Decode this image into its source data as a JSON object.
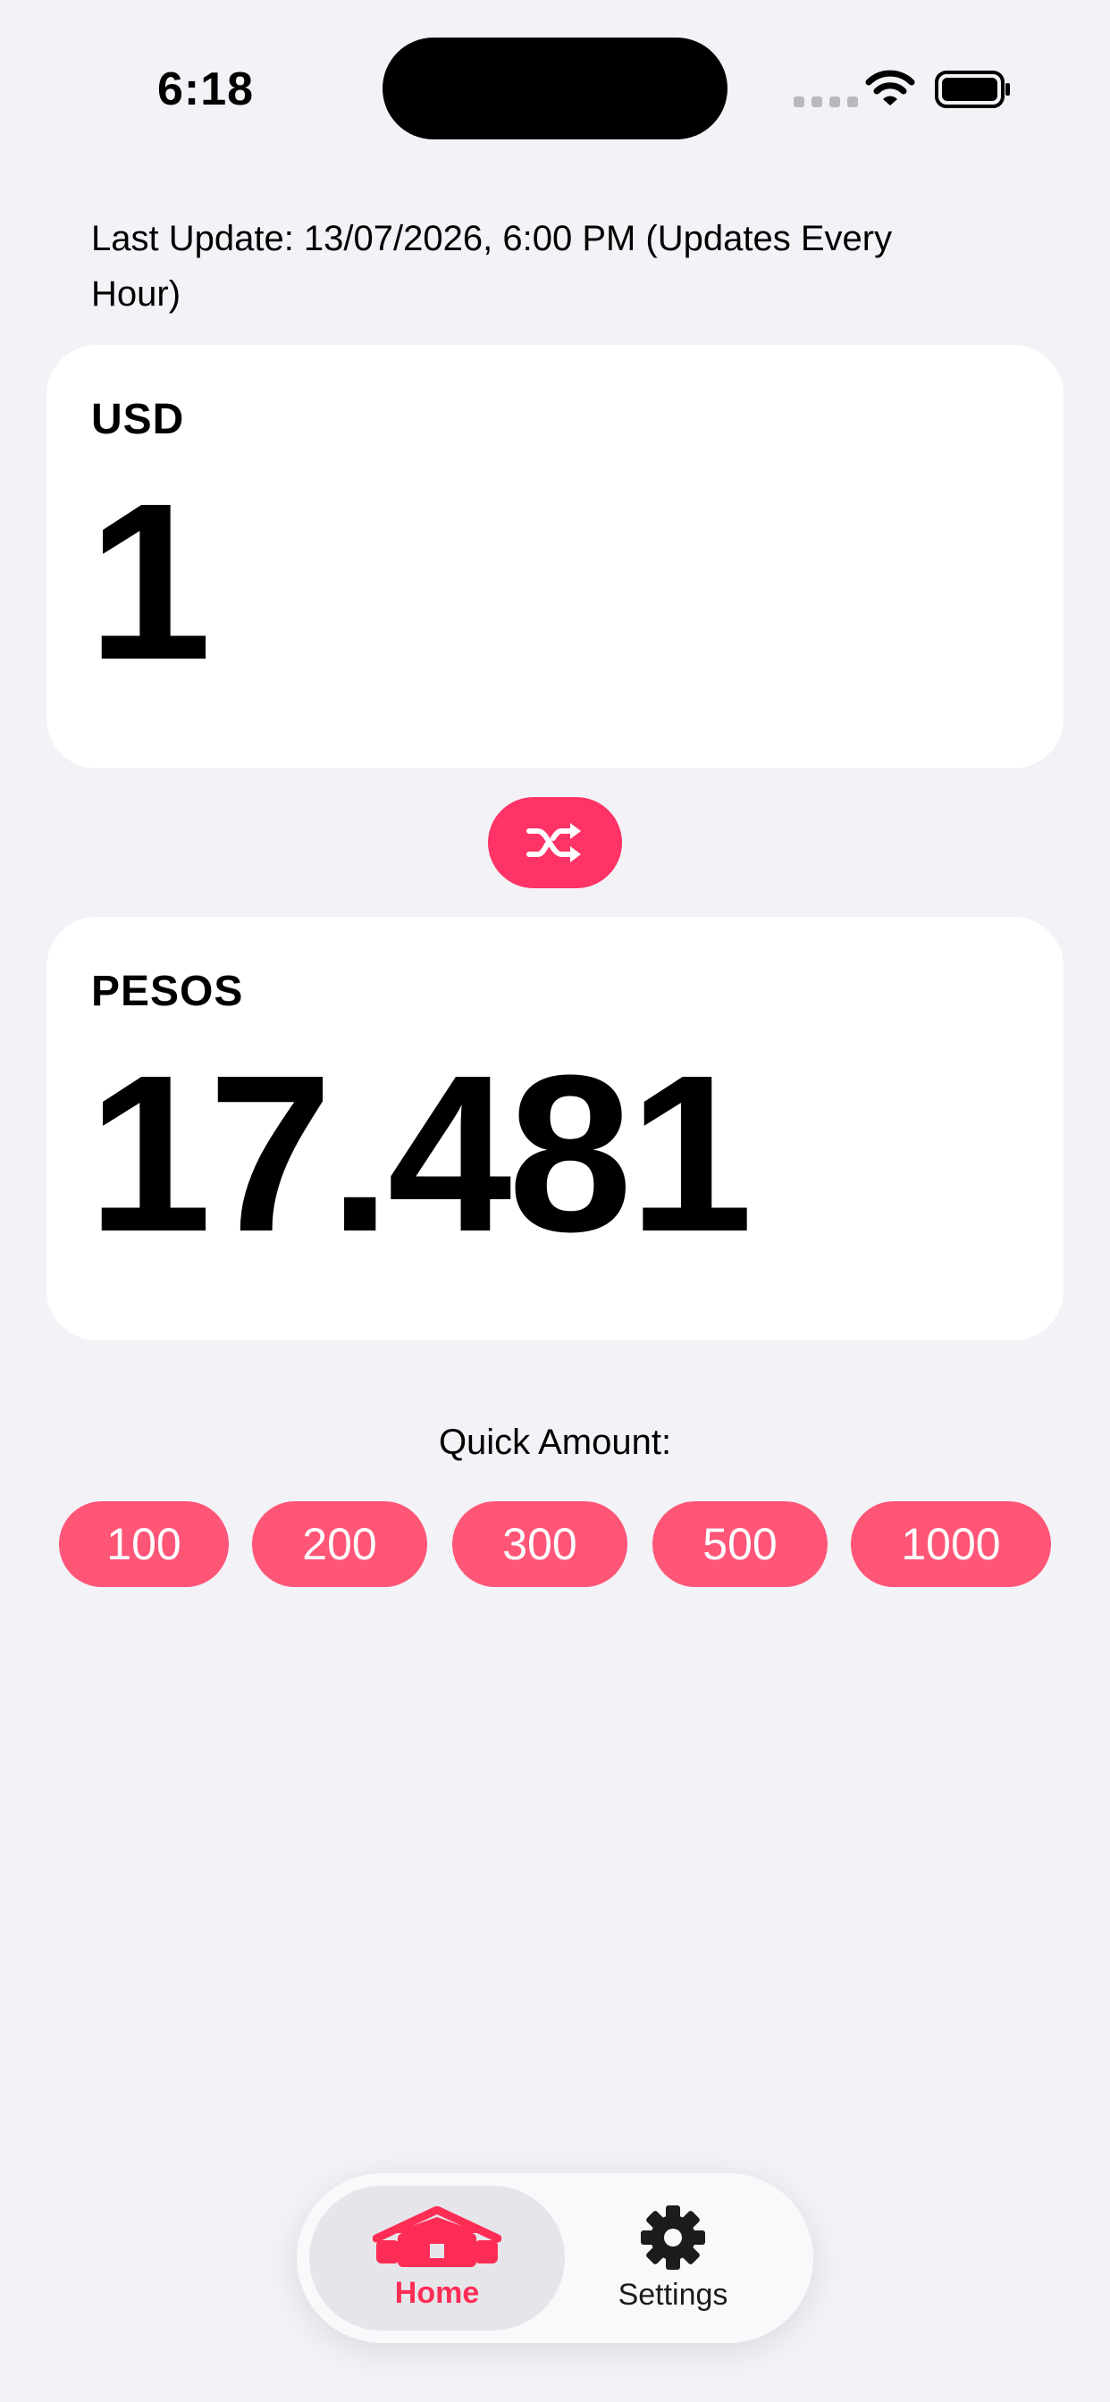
{
  "status_bar": {
    "time": "6:18"
  },
  "last_update": "Last Update: 13/07/2026, 6:00 PM (Updates Every Hour)",
  "from_card": {
    "label": "USD",
    "value": "1"
  },
  "to_card": {
    "label": "PESOS",
    "value": "17.481"
  },
  "swap_icon": "shuffle-icon",
  "quick_amount": {
    "label": "Quick Amount:",
    "options": [
      "100",
      "200",
      "300",
      "500",
      "1000"
    ]
  },
  "tabs": [
    {
      "label": "Home",
      "icon": "home-icon",
      "selected": true
    },
    {
      "label": "Settings",
      "icon": "gear-icon",
      "selected": false
    }
  ],
  "colors": {
    "accent": "#ff3366",
    "quick_button": "#ff5577",
    "background": "#f2f2f7"
  }
}
